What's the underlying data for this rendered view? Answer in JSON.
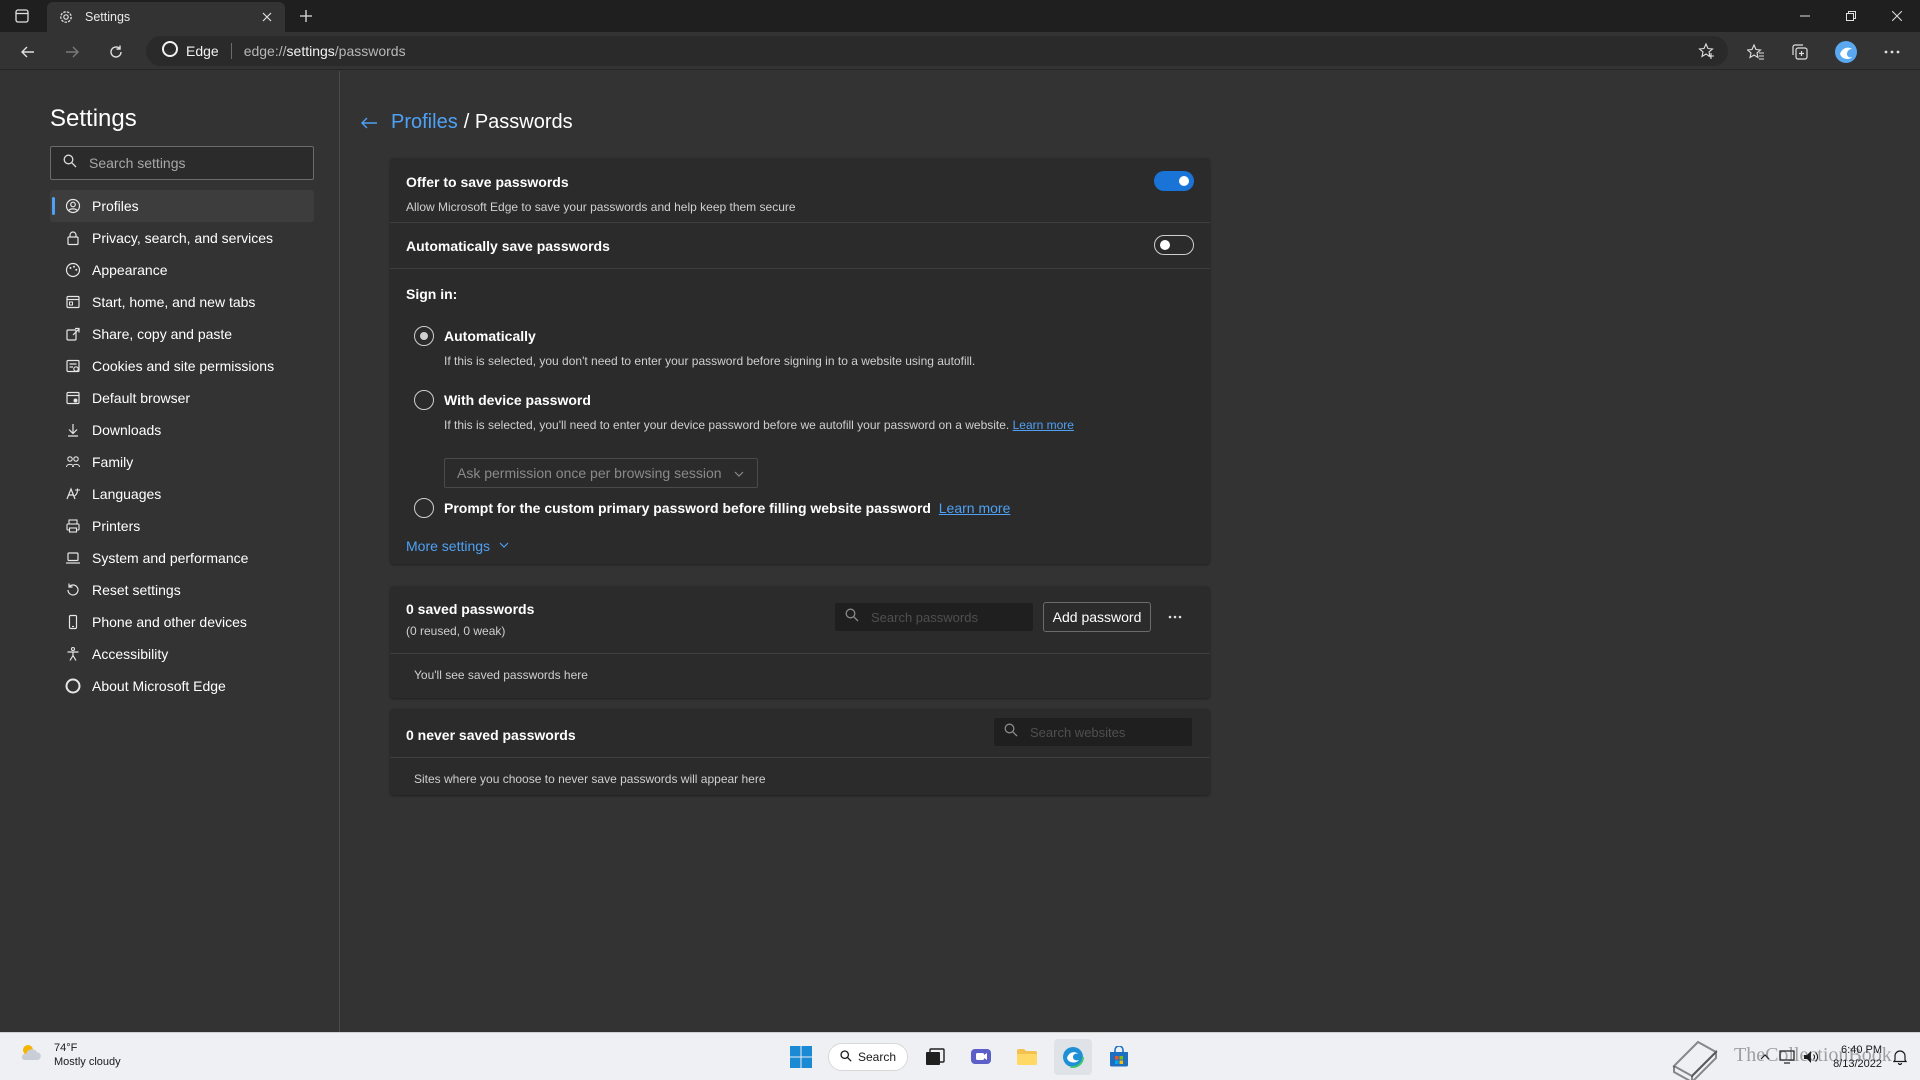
{
  "browser": {
    "tab_title": "Settings",
    "omnibox_badge": "Edge",
    "url_prefix": "edge://",
    "url_host": "settings",
    "url_path": "/passwords"
  },
  "sidebar": {
    "title": "Settings",
    "search_placeholder": "Search settings",
    "items": [
      {
        "label": "Profiles",
        "icon": "profile-icon"
      },
      {
        "label": "Privacy, search, and services",
        "icon": "lock-icon"
      },
      {
        "label": "Appearance",
        "icon": "appearance-icon"
      },
      {
        "label": "Start, home, and new tabs",
        "icon": "home-tabs-icon"
      },
      {
        "label": "Share, copy and paste",
        "icon": "share-icon"
      },
      {
        "label": "Cookies and site permissions",
        "icon": "cookies-icon"
      },
      {
        "label": "Default browser",
        "icon": "browser-icon"
      },
      {
        "label": "Downloads",
        "icon": "download-icon"
      },
      {
        "label": "Family",
        "icon": "family-icon"
      },
      {
        "label": "Languages",
        "icon": "languages-icon"
      },
      {
        "label": "Printers",
        "icon": "printer-icon"
      },
      {
        "label": "System and performance",
        "icon": "laptop-icon"
      },
      {
        "label": "Reset settings",
        "icon": "reset-icon"
      },
      {
        "label": "Phone and other devices",
        "icon": "phone-icon"
      },
      {
        "label": "Accessibility",
        "icon": "accessibility-icon"
      },
      {
        "label": "About Microsoft Edge",
        "icon": "edge-icon"
      }
    ]
  },
  "breadcrumb": {
    "parent": "Profiles",
    "current": "/ Passwords"
  },
  "passwords": {
    "offer_title": "Offer to save passwords",
    "offer_desc": "Allow Microsoft Edge to save your passwords and help keep them secure",
    "offer_on": true,
    "autosave_title": "Automatically save passwords",
    "autosave_on": false,
    "signin_title": "Sign in:",
    "options": [
      {
        "label": "Automatically",
        "desc": "If this is selected, you don't need to enter your password before signing in to a website using autofill.",
        "checked": true
      },
      {
        "label": "With device password",
        "desc": "If this is selected, you'll need to enter your device password before we autofill your password on a website.",
        "link": "Learn more",
        "checked": false
      },
      {
        "label": "Prompt for the custom primary password before filling website password",
        "link": "Learn more",
        "checked": false
      }
    ],
    "dropdown_value": "Ask permission once per browsing session",
    "more_settings": "More settings"
  },
  "saved": {
    "title": "0 saved passwords",
    "subtitle": "(0 reused, 0 weak)",
    "search_placeholder": "Search passwords",
    "add_button": "Add password",
    "empty_text": "You'll see saved passwords here"
  },
  "never_saved": {
    "title": "0 never saved passwords",
    "search_placeholder": "Search websites",
    "empty_text": "Sites where you choose to never save passwords will appear here"
  },
  "taskbar": {
    "weather_temp": "74°F",
    "weather_desc": "Mostly cloudy",
    "search_label": "Search",
    "time": "6:40 PM",
    "date": "8/13/2022"
  },
  "watermark": {
    "text": "TheCollectionBook"
  },
  "colors": {
    "accent": "#4ea1f5",
    "toggle_on": "#1a73d6",
    "background": "#333333",
    "card": "#2b2b2b"
  }
}
